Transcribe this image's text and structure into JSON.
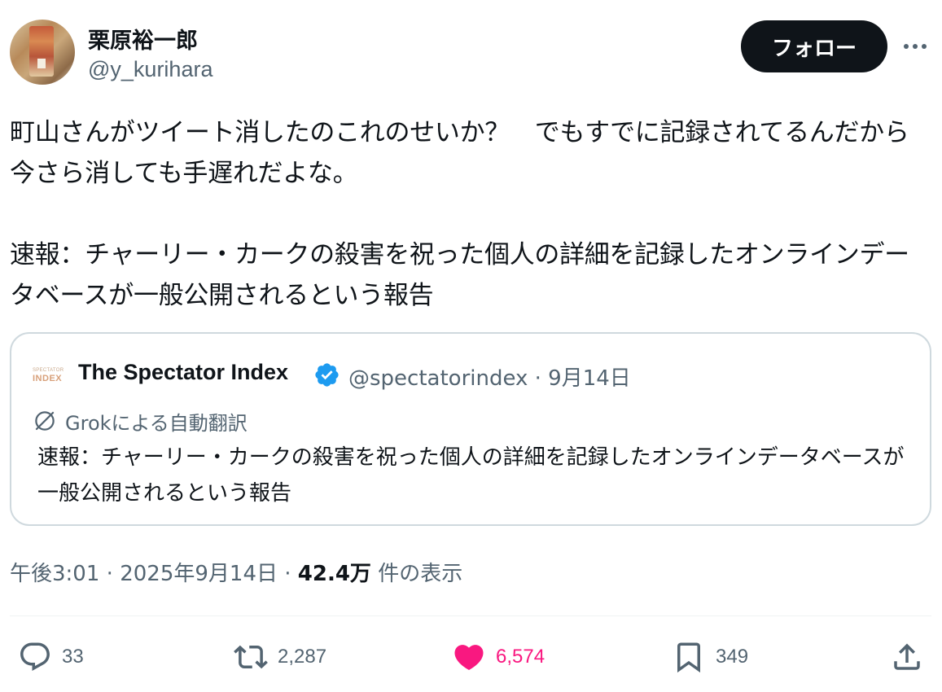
{
  "author": {
    "display_name": "栗原裕一郎",
    "handle": "@y_kurihara"
  },
  "actions_top": {
    "follow_label": "フォロー"
  },
  "tweet": {
    "text": "町山さんがツイート消したのこれのせいか？　でもすでに記録されてるんだから今さら消しても手遅れだよな。\n\n速報：チャーリー・カークの殺害を祝った個人の詳細を記録したオンラインデータベースが一般公開されるという報告"
  },
  "quote": {
    "logo_line1": "SPECTATOR",
    "logo_line2": "INDEX",
    "name": "The Spectator Index",
    "handle_date": "@spectatorindex · 9月14日",
    "translation_label": "Grokによる自動翻訳",
    "text": "速報：チャーリー・カークの殺害を祝った個人の詳細を記録したオンラインデータベースが一般公開されるという報告"
  },
  "meta": {
    "time": "午後3:01",
    "sep1": " · ",
    "date": "2025年9月14日",
    "sep2": " · ",
    "views": "42.4万",
    "views_label": " 件の表示"
  },
  "stats": {
    "replies": "33",
    "retweets": "2,287",
    "likes": "6,574",
    "bookmarks": "349"
  },
  "colors": {
    "like": "#f91880",
    "verified": "#1d9bf0",
    "secondary_text": "#536471"
  },
  "icons": [
    "reply-icon",
    "retweet-icon",
    "like-icon",
    "bookmark-icon",
    "share-icon",
    "verified-icon",
    "translate-icon",
    "more-icon"
  ]
}
